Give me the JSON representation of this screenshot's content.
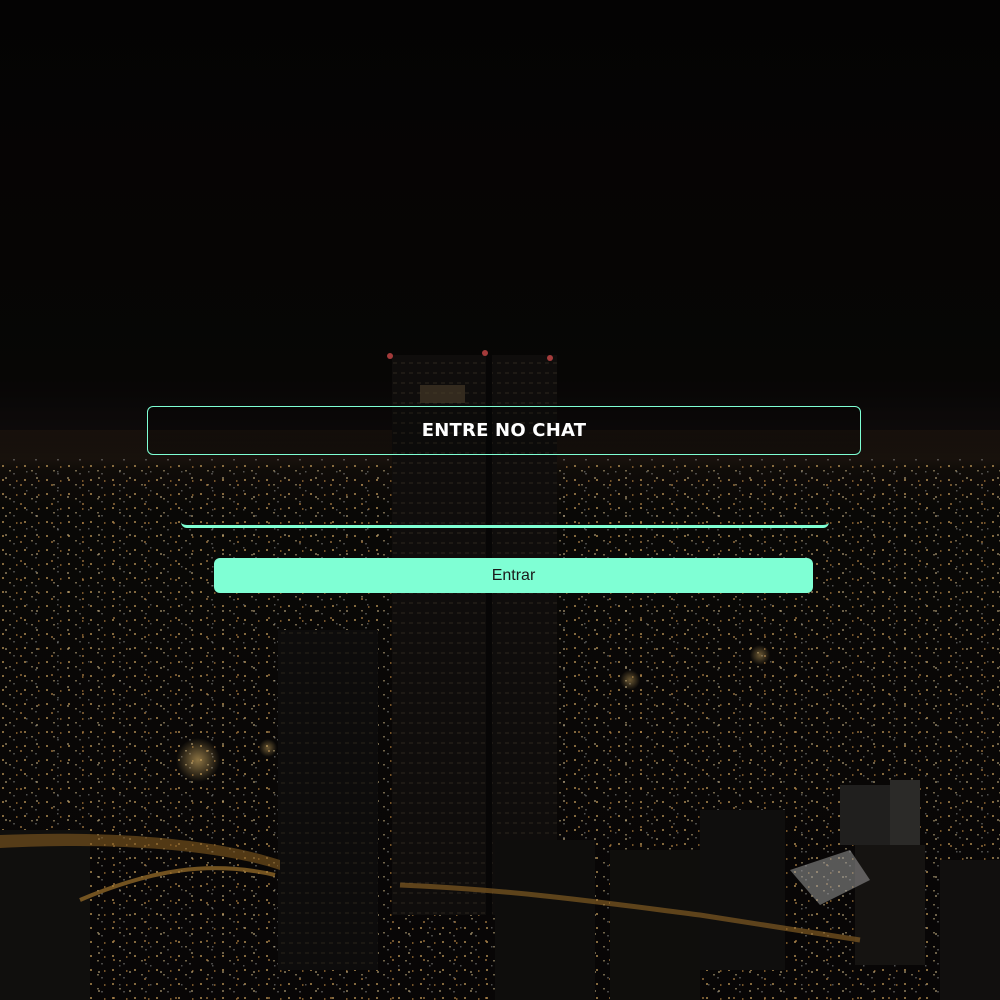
{
  "login": {
    "title": "ENTRE NO CHAT",
    "name_input_value": "",
    "name_input_placeholder": "",
    "enter_label": "Entrar"
  },
  "colors": {
    "accent": "#7fffd4",
    "button_text": "#1a1a1a",
    "title_text": "#ffffff"
  },
  "background": {
    "icon": "night-city-skyline-image"
  }
}
